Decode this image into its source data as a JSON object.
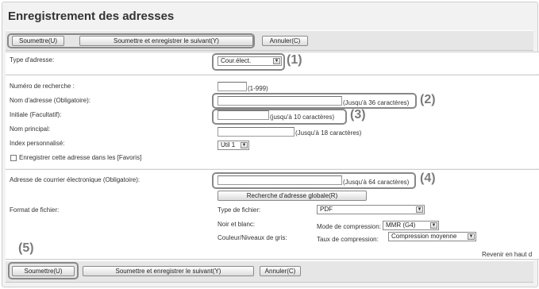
{
  "page": {
    "title": "Enregistrement des adresses"
  },
  "toolbar": {
    "submit": "Soumettre(U)",
    "submit_next": "Soumettre et enregistrer le suivant(Y)",
    "cancel": "Annuler(C)"
  },
  "address_type": {
    "label": "Type d'adresse:",
    "value": "Cour.élect."
  },
  "form": {
    "search_number_label": "Numéro de recherche :",
    "search_number_hint": "(1-999)",
    "search_number_value": "",
    "address_name_label": "Nom d'adresse (Obligatoire):",
    "address_name_hint": "(Jusqu'à 36 caractères)",
    "address_name_value": "",
    "initial_label": "Initiale (Facultatif):",
    "initial_hint": "(jusqu'à 10 caractères)",
    "initial_value": "",
    "main_name_label": "Nom principal:",
    "main_name_hint": "(Jusqu'à 18 caractères)",
    "main_name_value": "",
    "custom_index_label": "Index personnalisé:",
    "custom_index_value": "Util 1",
    "favorites_label": "Enregistrer cette adresse dans les [Favoris]",
    "favorites_checked": false
  },
  "email": {
    "label": "Adresse de courrier électronique (Obligatoire):",
    "hint": "(Jusqu'à 64 caractères)",
    "value": "",
    "global_search_button": "Recherche d'adresse globale(R)"
  },
  "file_format": {
    "label": "Format de fichier:",
    "file_type_label": "Type de fichier:",
    "file_type_value": "PDF",
    "bw_label": "Noir et blanc:",
    "compression_mode_label": "Mode de compression:",
    "compression_mode_value": "MMR (G4)",
    "color_label": "Couleur/Niveaux de gris:",
    "compression_rate_label": "Taux de compression:",
    "compression_rate_value": "Compression moyenne"
  },
  "back_to_top": "Revenir en haut d",
  "callouts": [
    "(1)",
    "(2)",
    "(3)",
    "(4)",
    "(5)"
  ],
  "colors": {
    "background": "#f2f2f2",
    "panel": "#ffffff",
    "button_bar": "#e6e6e6",
    "callout": "#888888",
    "text": "#333333"
  }
}
